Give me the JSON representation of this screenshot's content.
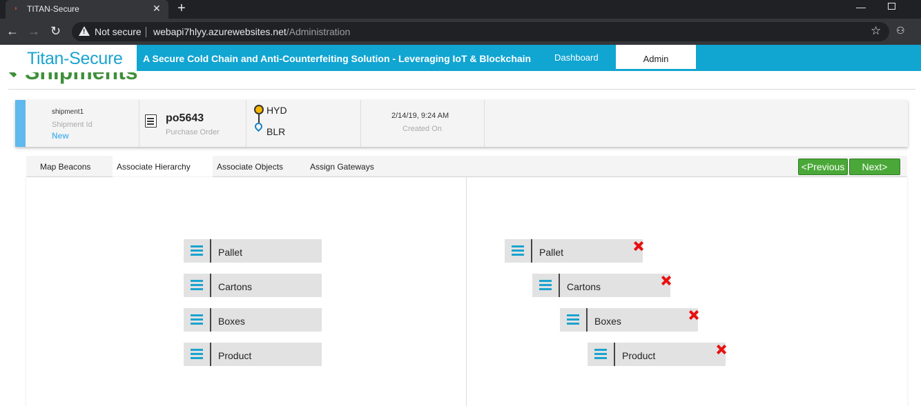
{
  "browser": {
    "tab_title": "TITAN-Secure",
    "tab_close": "✕",
    "new_tab": "+",
    "security_label": "Not secure",
    "url_host": "webapi7hlyy.azurewebsites.net",
    "url_path": "/Administration"
  },
  "app": {
    "brand": "Titan-Secure",
    "tagline": "A Secure Cold Chain and Anti-Counterfeiting Solution - Leveraging IoT & Blockchain",
    "nav": {
      "dashboard": "Dashboard",
      "admin": "Admin"
    },
    "page_title": "Shipments"
  },
  "shipment": {
    "name": "shipment1",
    "id_label": "Shipment Id",
    "status": "New",
    "po_number": "po5643",
    "po_label": "Purchase Order",
    "from": "HYD",
    "to": "BLR",
    "created_at": "2/14/19, 9:24 AM",
    "created_label": "Created On"
  },
  "wizard": {
    "tabs": [
      "Map Beacons",
      "Associate Hierarchy",
      "Associate Objects",
      "Assign Gateways"
    ],
    "active_tab": "Associate Hierarchy",
    "prev_label": "<Previous",
    "next_label": "Next>"
  },
  "hierarchy": {
    "available": [
      "Pallet",
      "Cartons",
      "Boxes",
      "Product"
    ],
    "selected": [
      "Pallet",
      "Cartons",
      "Boxes",
      "Product"
    ]
  },
  "colors": {
    "brand_blue": "#11a5d2",
    "brand_green": "#3f8f3a",
    "button_green": "#4aa838",
    "remove_red": "#e81010"
  }
}
